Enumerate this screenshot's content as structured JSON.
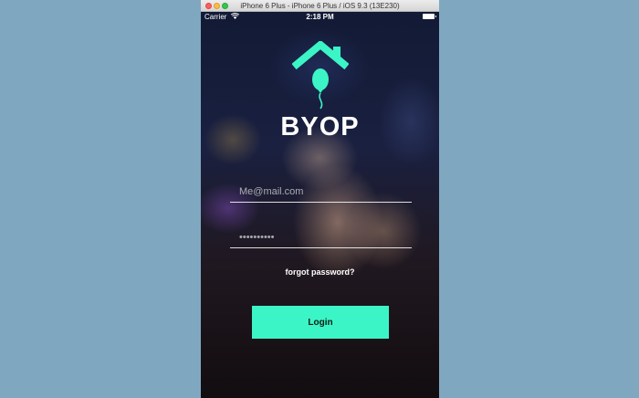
{
  "window": {
    "title": "iPhone 6 Plus - iPhone 6 Plus / iOS 9.3 (13E230)"
  },
  "status_bar": {
    "carrier": "Carrier",
    "time": "2:18 PM",
    "icons": [
      "wifi-icon",
      "battery-icon"
    ]
  },
  "app": {
    "name": "BYOP",
    "logo_icon": "house-balloon-icon",
    "accent_color": "#3cf5c6",
    "email": {
      "placeholder": "Me@mail.com",
      "value": ""
    },
    "password": {
      "placeholder": "••••••••••",
      "value": ""
    },
    "forgot_password_label": "forgot password?",
    "login_label": "Login"
  }
}
